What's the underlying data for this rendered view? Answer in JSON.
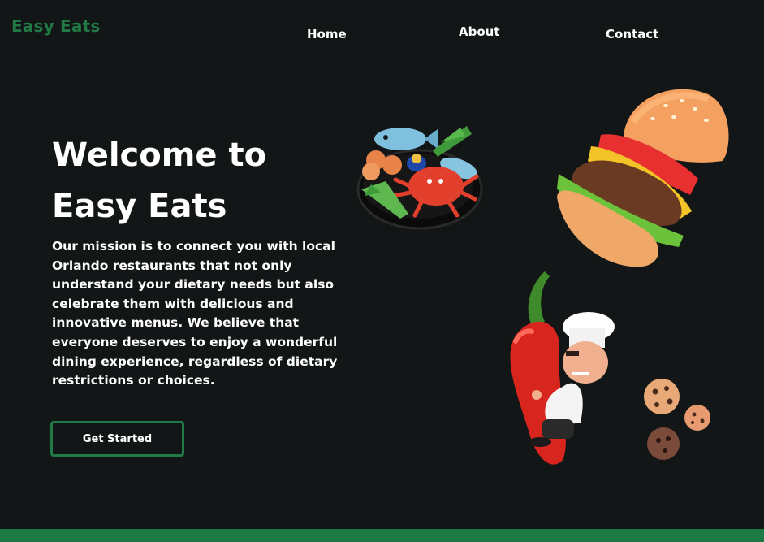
{
  "brand": {
    "name": "Easy Eats"
  },
  "nav": {
    "home": "Home",
    "about": "About",
    "contact": "Contact"
  },
  "hero": {
    "title_line1": "Welcome to",
    "title_line2": "Easy Eats",
    "description": "Our mission is to connect you with local Orlando restaurants that not only understand your dietary needs but also celebrate them with delicious and innovative menus. We believe that everyone deserves to enjoy a wonderful dining experience, regardless of dietary restrictions or choices.",
    "cta_label": "Get Started"
  },
  "illustrations": [
    {
      "name": "seafood-plate-illustration"
    },
    {
      "name": "burger-illustration"
    },
    {
      "name": "chef-with-chili-illustration"
    },
    {
      "name": "cookies-illustration"
    }
  ],
  "colors": {
    "background": "#131616",
    "accent": "#1f7a45",
    "text": "#ffffff"
  }
}
